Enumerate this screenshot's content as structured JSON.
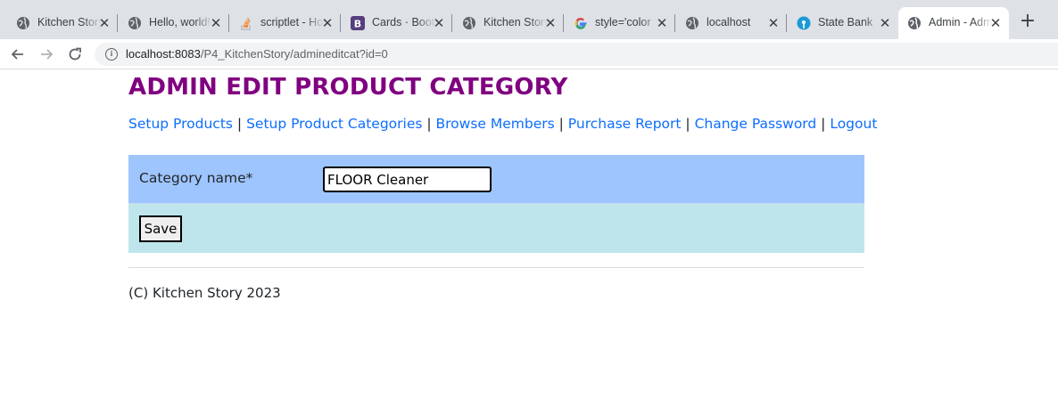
{
  "browser": {
    "tabs": [
      {
        "title": "Kitchen Story",
        "icon": "globe-icon",
        "active": false
      },
      {
        "title": "Hello, world!",
        "icon": "globe-icon",
        "active": false
      },
      {
        "title": "scriptlet - How",
        "icon": "stackoverflow-icon",
        "active": false
      },
      {
        "title": "Cards · Bootstrap",
        "icon": "bootstrap-icon",
        "active": false
      },
      {
        "title": "Kitchen Story",
        "icon": "globe-icon",
        "active": false
      },
      {
        "title": "style='color",
        "icon": "google-icon",
        "active": false
      },
      {
        "title": "localhost",
        "icon": "globe-icon",
        "active": false
      },
      {
        "title": "State Bank",
        "icon": "sbi-icon",
        "active": false
      },
      {
        "title": "Admin - Admin",
        "icon": "globe-icon",
        "active": true
      }
    ],
    "new_tab_label": "+",
    "close_glyph": "✕",
    "url_host": "localhost:8083",
    "url_path": "/P4_KitchenStory/admineditcat?id=0"
  },
  "page": {
    "title": "ADMIN EDIT PRODUCT CATEGORY",
    "nav": [
      "Setup Products",
      "Setup Product Categories",
      "Browse Members",
      "Purchase Report",
      "Change Password",
      "Logout"
    ],
    "separator": " | ",
    "form": {
      "category_label": "Category name*",
      "category_value": "FLOOR Cleaner",
      "save_label": "Save"
    },
    "footer": "(C) Kitchen Story 2023"
  },
  "colors": {
    "title": "#800080",
    "link": "#0d6efd",
    "row1_bg": "#9ec5fe",
    "row2_bg": "#bee5eb"
  }
}
